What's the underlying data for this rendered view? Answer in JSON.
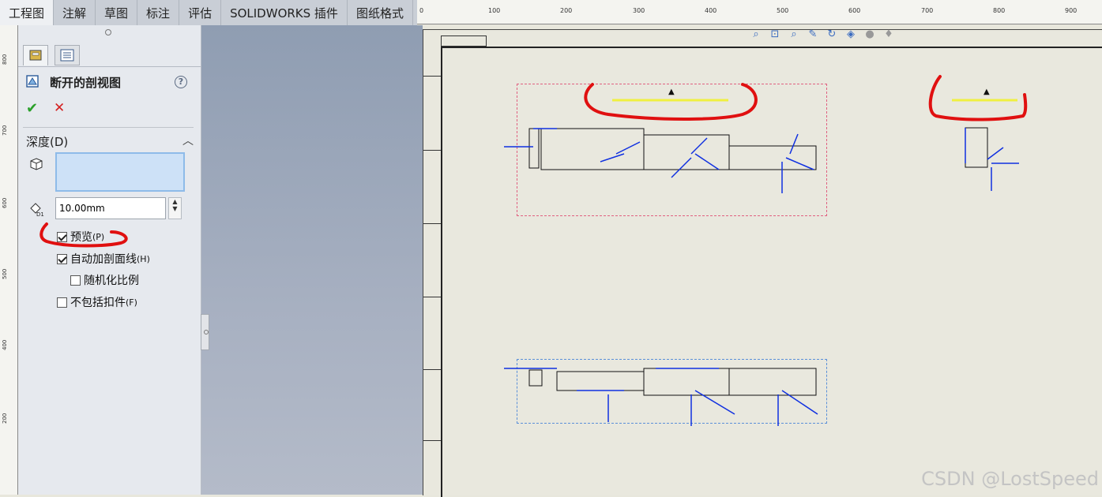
{
  "tabs": [
    "工程图",
    "注解",
    "草图",
    "标注",
    "评估",
    "SOLIDWORKS 插件",
    "图纸格式"
  ],
  "active_tab": "工程图",
  "vruler_labels": [
    "800",
    "700",
    "600",
    "500",
    "400",
    "200"
  ],
  "hruler_labels": [
    "0",
    "100",
    "200",
    "300",
    "400",
    "500",
    "600",
    "700",
    "800",
    "900"
  ],
  "pm": {
    "title": "断开的剖视图",
    "help": "?",
    "ok": "✔",
    "cancel": "✕",
    "section": "深度(D)",
    "depth_value": "10.00mm",
    "depth_icon_label": "D1",
    "preview": {
      "label": "预览",
      "hotkey": "(P)",
      "checked": true
    },
    "auto_hatch": {
      "label": "自动加剖面线",
      "hotkey": "(H)",
      "checked": true
    },
    "randomize": {
      "label": "随机化比例",
      "checked": false
    },
    "exclude_fasteners": {
      "label": "不包括扣件",
      "hotkey": "(F)",
      "checked": false
    }
  },
  "toolbar_icons": [
    "zoom-fit-icon",
    "zoom-area-icon",
    "zoom-icon",
    "pan-icon",
    "rotate-icon",
    "view-orientation-icon",
    "display-style-icon",
    "hide-show-icon",
    "appearance-icon"
  ],
  "watermark": "CSDN @LostSpeed",
  "colors": {
    "annotation_red": "#e01010",
    "highlight_yellow": "#f0f040",
    "arrow_blue": "#1030e0"
  }
}
